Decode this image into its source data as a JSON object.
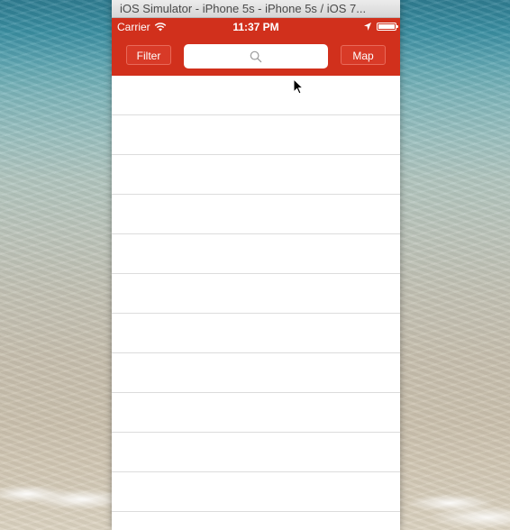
{
  "window": {
    "title": "iOS Simulator - iPhone 5s - iPhone 5s / iOS 7..."
  },
  "status_bar": {
    "carrier": "Carrier",
    "time": "11:37 PM",
    "icons": [
      "wifi-icon",
      "location-icon",
      "battery-icon"
    ]
  },
  "nav": {
    "filter_label": "Filter",
    "map_label": "Map",
    "search_value": "",
    "search_icon": "search-icon"
  },
  "list": {
    "rows": [
      "",
      "",
      "",
      "",
      "",
      "",
      "",
      "",
      "",
      "",
      "",
      ""
    ]
  },
  "colors": {
    "nav_bar": "#d1301c",
    "button_bg": "#d83a27",
    "background": "#ffffff",
    "separator": "#dcdcdc"
  }
}
